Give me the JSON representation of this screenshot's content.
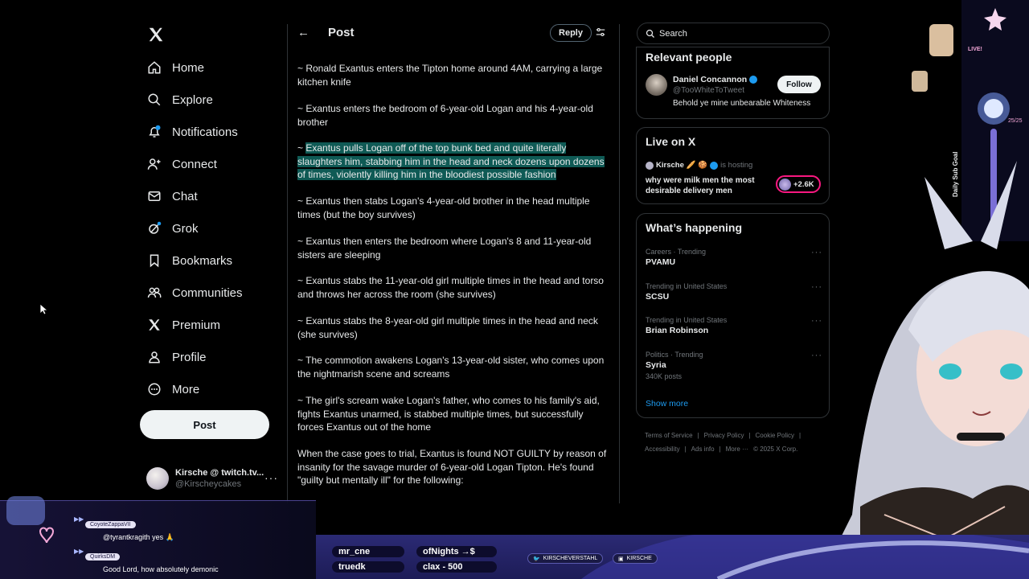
{
  "nav": {
    "items": [
      {
        "label": "Home",
        "icon": "home-icon"
      },
      {
        "label": "Explore",
        "icon": "search-icon"
      },
      {
        "label": "Notifications",
        "icon": "bell-icon"
      },
      {
        "label": "Connect",
        "icon": "person-add-icon"
      },
      {
        "label": "Chat",
        "icon": "mail-icon"
      },
      {
        "label": "Grok",
        "icon": "grok-icon"
      },
      {
        "label": "Bookmarks",
        "icon": "bookmark-icon"
      },
      {
        "label": "Communities",
        "icon": "communities-icon"
      },
      {
        "label": "Premium",
        "icon": "x-logo-icon"
      },
      {
        "label": "Profile",
        "icon": "profile-icon"
      },
      {
        "label": "More",
        "icon": "more-circle-icon"
      }
    ],
    "post_label": "Post",
    "account": {
      "name": "Kirsche @ twitch.tv...",
      "handle": "@Kirscheycakes"
    }
  },
  "post": {
    "header_title": "Post",
    "reply_label": "Reply",
    "paragraphs": [
      "~ Ronald Exantus enters the Tipton home around 4AM, carrying a large kitchen knife",
      "~ Exantus enters the bedroom of 6-year-old Logan and his 4-year-old brother",
      "~ Exantus then stabs Logan's 4-year-old brother in the head multiple times (but the boy survives)",
      "~ Exantus then enters the bedroom where Logan's 8 and 11-year-old sisters are sleeping",
      "~ Exantus stabs the 11-year-old girl multiple times in the head and torso and throws her across the room (she survives)",
      "~ Exantus stabs the 8-year-old girl multiple times in the head and neck (she survives)",
      "~ The commotion awakens Logan's 13-year-old sister, who comes upon the nightmarish scene and screams",
      "~ The girl's scream wake Logan's father, who comes to his family's aid, fights Exantus unarmed, is stabbed multiple times, but successfully forces Exantus out of the home",
      "When the case goes to trial, Exantus is found NOT GUILTY by reason of insanity for the savage murder of 6-year-old Logan Tipton. He's found \"guilty but mentally ill\" for the following:"
    ],
    "highlight_prefix": "~ ",
    "highlight_text": "Exantus pulls Logan off of the top bunk bed and quite literally slaughters him, stabbing him in the head and neck dozens upon dozens of times, violently killing him in the bloodiest possible fashion"
  },
  "sidebar": {
    "search_placeholder": "Search",
    "relevant": {
      "title": "Relevant people",
      "name": "Daniel Concannon",
      "handle": "@TooWhiteToTweet",
      "bio": "Behold ye mine unbearable Whiteness",
      "follow_label": "Follow"
    },
    "live": {
      "title": "Live on X",
      "host": "Kirsche",
      "host_suffix": "is hosting",
      "topic": "why were milk men the most desirable delivery men",
      "count": "+2.6K"
    },
    "happening": {
      "title": "What’s happening",
      "trends": [
        {
          "category": "Careers · Trending",
          "name": "PVAMU",
          "posts": ""
        },
        {
          "category": "Trending in United States",
          "name": "SCSU",
          "posts": ""
        },
        {
          "category": "Trending in United States",
          "name": "Brian Robinson",
          "posts": ""
        },
        {
          "category": "Politics · Trending",
          "name": "Syria",
          "posts": "340K posts"
        }
      ],
      "show_more": "Show more"
    },
    "footer": [
      "Terms of Service",
      "|",
      "Privacy Policy",
      "|",
      "Cookie Policy",
      "|",
      "Accessibility",
      "|",
      "Ads info",
      "|",
      "More ···",
      "© 2025 X Corp."
    ]
  },
  "overlay": {
    "chat": [
      {
        "user": "CoyoteZappaVII",
        "text": "@tyrantkragith yes 🙏"
      },
      {
        "user": "QuirksDM",
        "text": "Good Lord, how absolutely demonic"
      }
    ],
    "ticker": [
      "mr_cne",
      "ofNights →$",
      "truedk",
      "clax - 500"
    ],
    "socials": [
      "KIRSCHEVERSTAHL",
      "KIRSCHE"
    ],
    "goal": {
      "label": "Daily Sub Goal",
      "progress": "25/25",
      "live": "LIVE!"
    }
  },
  "colors": {
    "accent": "#1d9bf0",
    "highlight": "#0f5a55",
    "live_pink": "#f91880"
  }
}
